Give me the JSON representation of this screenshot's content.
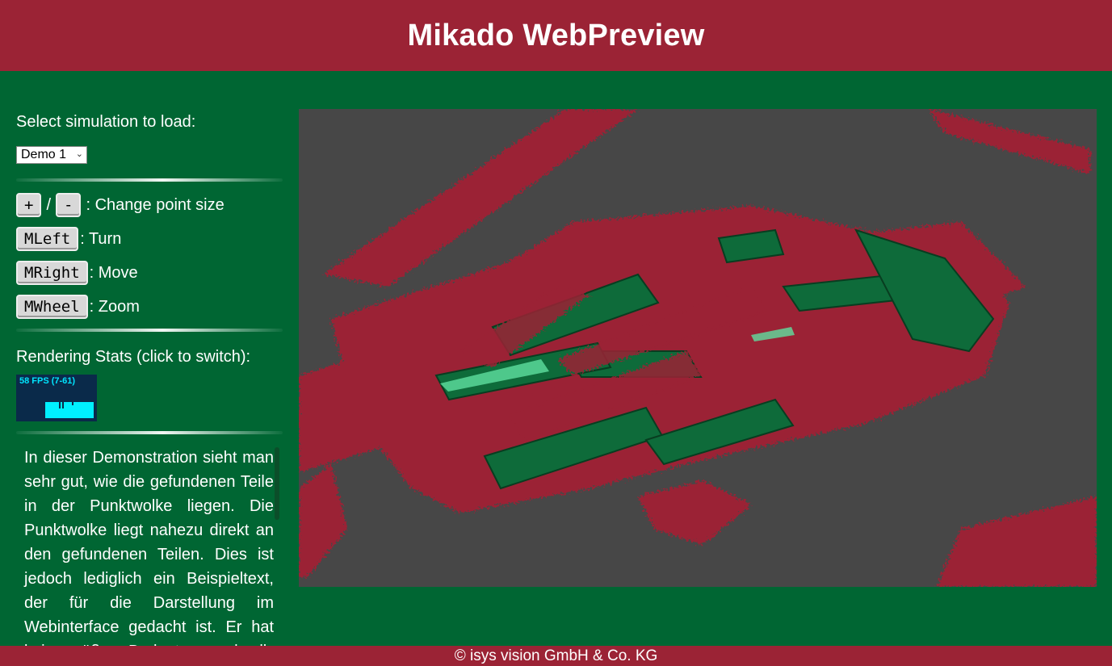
{
  "header": {
    "title": "Mikado WebPreview"
  },
  "sidebar": {
    "select_label": "Select simulation to load:",
    "select_value": "Demo 1",
    "controls": [
      {
        "keys": [
          "+",
          "-"
        ],
        "separator": "/",
        "description": ": Change point size"
      },
      {
        "keys": [
          "MLeft"
        ],
        "description": ": Turn"
      },
      {
        "keys": [
          "MRight"
        ],
        "description": ": Move"
      },
      {
        "keys": [
          "MWheel"
        ],
        "description": ": Zoom"
      }
    ],
    "stats_label": "Rendering Stats (click to switch):",
    "stats_fps": "58 FPS (7-61)",
    "description": "In dieser Demonstration sieht man sehr gut, wie die gefundenen Teile in der Punktwolke liegen. Die Punktwolke liegt nahezu direkt an den gefundenen Teilen. Dies ist jedoch lediglich ein Beispieltext, der für die Darstellung im Webinterface gedacht ist. Er hat keine größere Bedeutung und soll"
  },
  "footer": {
    "copyright": "© isys vision GmbH & Co. KG"
  },
  "colors": {
    "header_bg": "#9b2335",
    "page_bg": "#006633",
    "viewer_bg": "#474747",
    "point_cloud": "#9b2335",
    "parts": "#0e6b3a"
  }
}
